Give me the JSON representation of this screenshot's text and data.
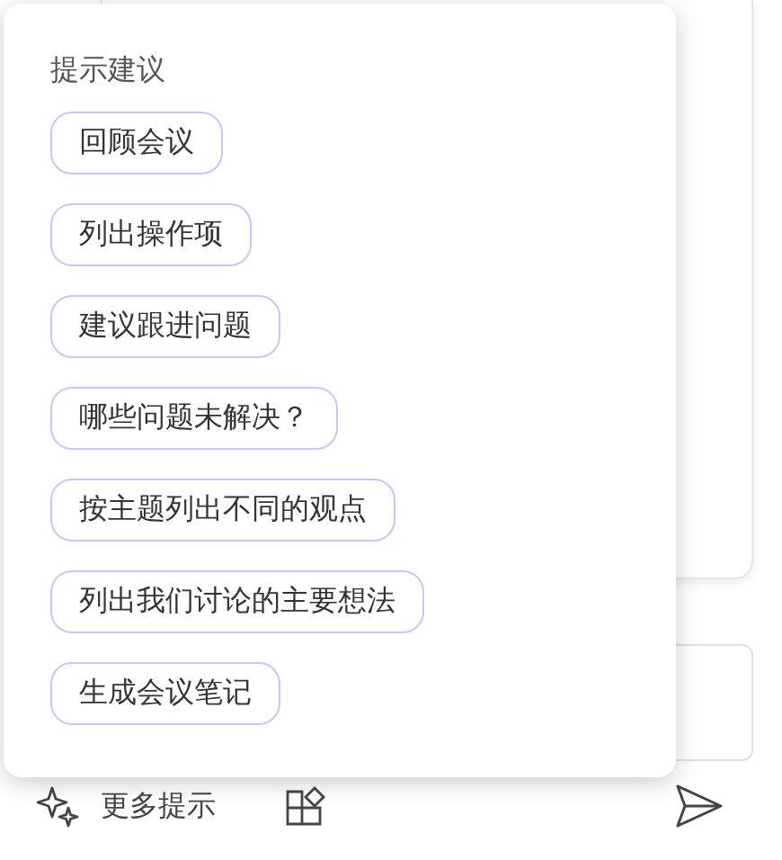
{
  "suggestions_popup": {
    "title": "提示建议",
    "prompts": [
      {
        "label": "回顾会议"
      },
      {
        "label": "列出操作项"
      },
      {
        "label": "建议跟进问题"
      },
      {
        "label": "哪些问题未解决？"
      },
      {
        "label": "按主题列出不同的观点"
      },
      {
        "label": "列出我们讨论的主要想法"
      },
      {
        "label": "生成会议笔记"
      }
    ]
  },
  "toolbar": {
    "more_prompts": "更多提示"
  }
}
